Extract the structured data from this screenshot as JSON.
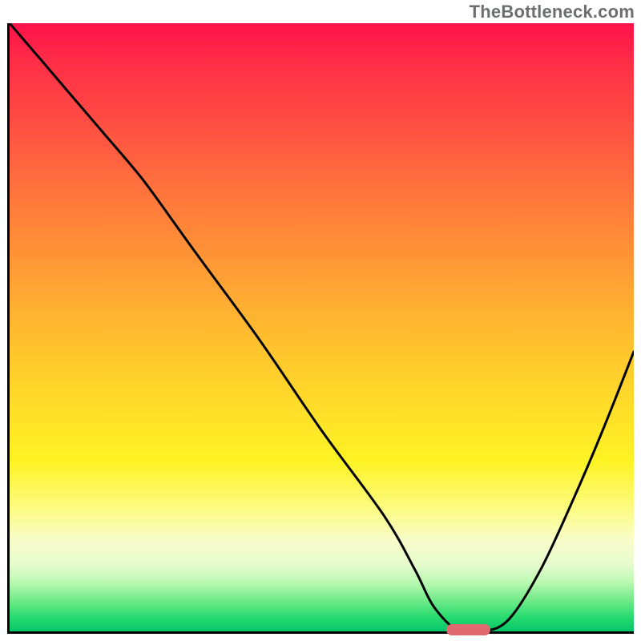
{
  "watermark": "TheBottleneck.com",
  "colors": {
    "curve_stroke": "#000000",
    "marker_fill": "#e06a6f",
    "axis_stroke": "#000000"
  },
  "chart_data": {
    "type": "line",
    "title": "",
    "xlabel": "",
    "ylabel": "",
    "xlim": [
      0,
      100
    ],
    "ylim": [
      0,
      100
    ],
    "x": [
      0,
      5,
      10,
      15,
      20,
      23,
      30,
      40,
      50,
      60,
      65,
      68,
      72,
      76,
      80,
      85,
      90,
      95,
      100
    ],
    "values": [
      100,
      94,
      88,
      82,
      76,
      72,
      62,
      48,
      33,
      19,
      10,
      4,
      0,
      0,
      2,
      10,
      21,
      33,
      46
    ],
    "marker": {
      "x_start": 70,
      "x_end": 77,
      "y": 0
    },
    "annotations": []
  }
}
